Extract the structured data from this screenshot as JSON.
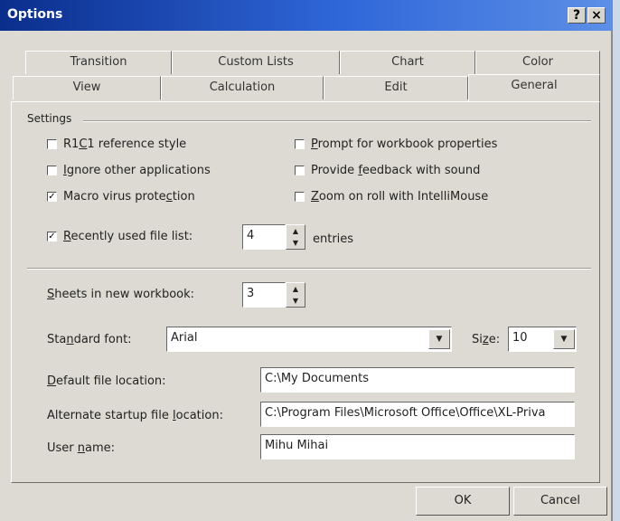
{
  "window": {
    "title": "Options",
    "help_label": "?",
    "close_label": "×"
  },
  "tabs_back": [
    "Transition",
    "Custom Lists",
    "Chart",
    "Color"
  ],
  "tabs_front": [
    "View",
    "Calculation",
    "Edit",
    "General"
  ],
  "active_tab": "General",
  "settings": {
    "group_label": "Settings",
    "r1c1": {
      "label_a": "R1",
      "label_u": "C",
      "label_b": "1 reference style",
      "checked": false
    },
    "ignore": {
      "label_u": "I",
      "label_b": "gnore other applications",
      "checked": false
    },
    "macro": {
      "label_a": "Macro virus prote",
      "label_u": "c",
      "label_b": "tion",
      "checked": true
    },
    "prompt": {
      "label_u": "P",
      "label_b": "rompt for workbook properties",
      "checked": false
    },
    "feedback": {
      "label_a": "Provide ",
      "label_u": "f",
      "label_b": "eedback with sound",
      "checked": false
    },
    "zoom": {
      "label_u": "Z",
      "label_b": "oom on roll with IntelliMouse",
      "checked": false
    },
    "recent": {
      "label_u": "R",
      "label_b": "ecently used file list:",
      "checked": true,
      "value": "4",
      "suffix": "entries"
    }
  },
  "sheets": {
    "label_u": "S",
    "label_b": "heets in new workbook:",
    "value": "3"
  },
  "font": {
    "label_a": "Sta",
    "label_u": "n",
    "label_b": "dard font:",
    "value": "Arial",
    "size_label_a": "Si",
    "size_label_u": "z",
    "size_label_b": "e:",
    "size_value": "10"
  },
  "default_location": {
    "label_u": "D",
    "label_b": "efault file location:",
    "value": "C:\\My Documents"
  },
  "alternate_location": {
    "label_a": "Alternate startup file ",
    "label_u": "l",
    "label_b": "ocation:",
    "value": "C:\\Program Files\\Microsoft Office\\Office\\XL-Priva"
  },
  "user_name": {
    "label_a": "User ",
    "label_u": "n",
    "label_b": "ame:",
    "value": "Mihu Mihai"
  },
  "buttons": {
    "ok": "OK",
    "cancel": "Cancel"
  }
}
